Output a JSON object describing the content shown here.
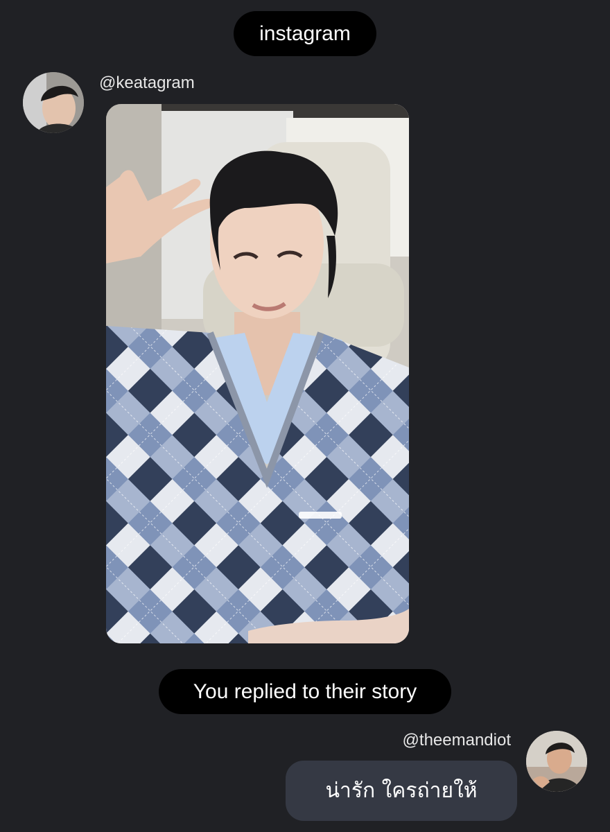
{
  "app_name": "instagram",
  "story_reply": {
    "sender": {
      "username": "@keatagram",
      "avatar": "profile-photo"
    },
    "story_media": "story-photo",
    "reply_notice": "You replied to their story"
  },
  "my_message": {
    "username": "@theemandiot",
    "avatar": "profile-photo",
    "text": "น่ารัก ใครถ่ายให้"
  },
  "colors": {
    "background": "#202125",
    "pill": "#000000",
    "bubble": "#353944"
  }
}
